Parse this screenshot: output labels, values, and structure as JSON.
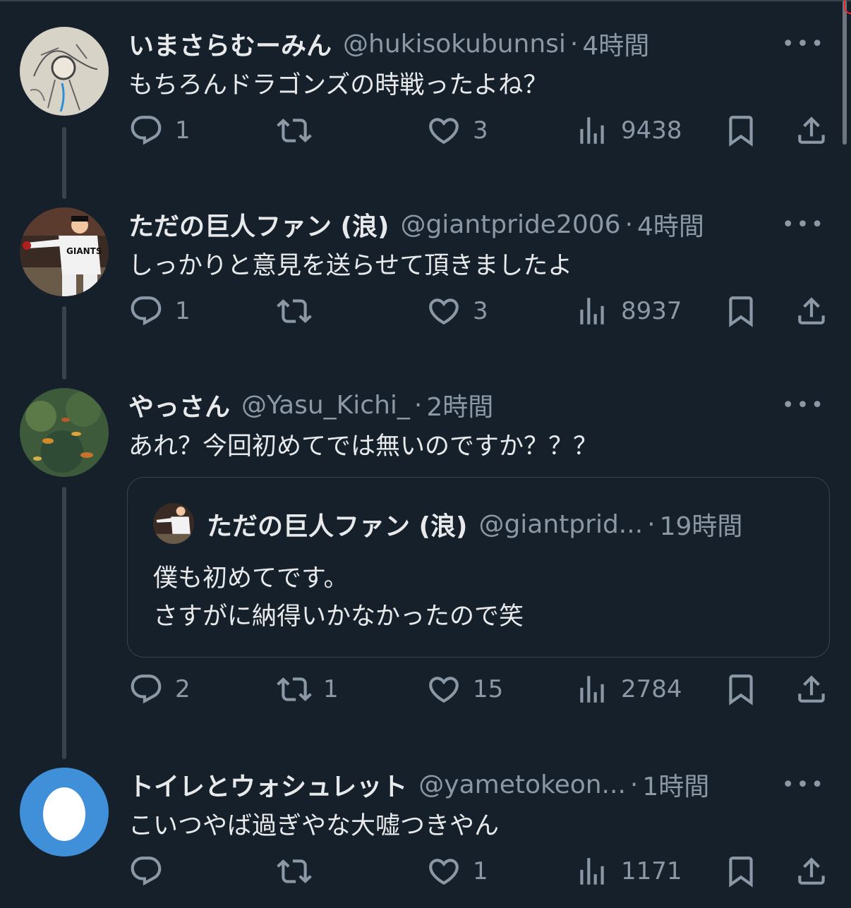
{
  "tweets": [
    {
      "name": "いまさらむーみん",
      "handle": "@hukisokubunnsi",
      "time": "4時間",
      "text": "もちろんドラゴンズの時戦ったよね？",
      "replies": "1",
      "retweets": "",
      "likes": "3",
      "views": "9438",
      "avatar": "sketch-art"
    },
    {
      "name": "ただの巨人ファン (浪)",
      "handle": "@giantpride2006",
      "time": "4時間",
      "text": "しっかりと意見を送らせて頂きましたよ",
      "replies": "1",
      "retweets": "",
      "likes": "3",
      "views": "8937",
      "avatar": "giants-player"
    },
    {
      "name": "やっさん",
      "handle": "@Yasu_Kichi_",
      "time": "2時間",
      "text": "あれ？今回初めてでは無いのですか？？？",
      "replies": "2",
      "retweets": "1",
      "likes": "15",
      "views": "2784",
      "avatar": "koi-pond",
      "quote": {
        "name": "ただの巨人ファン (浪)",
        "handle": "@giantprid...",
        "time": "19時間",
        "text": "僕も初めてです。\nさすがに納得いかなかったので笑"
      }
    },
    {
      "name": "トイレとウォシュレット",
      "handle": "@yametokeon...",
      "time": "1時間",
      "text": "こいつやば過ぎやな大嘘つきやん",
      "replies": "",
      "retweets": "",
      "likes": "1",
      "views": "1171",
      "avatar": "default-egg"
    }
  ],
  "more_label": "•••",
  "dot": "·",
  "colors": {
    "background": "#15202b",
    "text": "#e7e9ea",
    "muted": "#8b98a5",
    "border": "#38444d",
    "egg_bg": "#3f8fd9"
  },
  "icons": [
    "reply-icon",
    "retweet-icon",
    "like-icon",
    "views-icon",
    "bookmark-icon",
    "share-icon",
    "more-icon"
  ]
}
